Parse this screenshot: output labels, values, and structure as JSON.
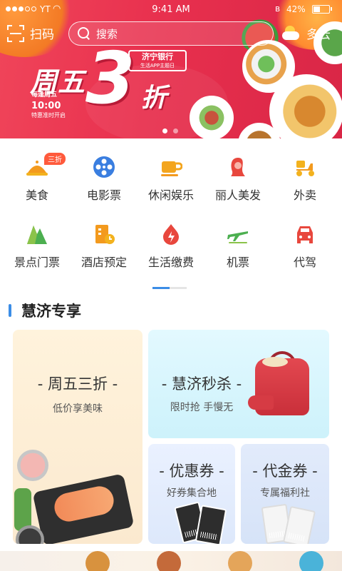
{
  "status_bar": {
    "carrier": "YT",
    "time": "9:41 AM",
    "battery_percent": "42%",
    "battery_level": 0.42
  },
  "header": {
    "scan_label": "扫码",
    "search_placeholder": "搜索",
    "weather_label": "多云"
  },
  "banner": {
    "title_prefix": "周五",
    "big_number": "3",
    "title_suffix": "折",
    "bank_name": "济宁银行",
    "bank_sub": "生活APP主题日",
    "schedule": "每逢周五",
    "time": "10:00",
    "note": "特惠准时开启",
    "page_count": 2,
    "active_page": 1
  },
  "categories": [
    {
      "label": "美食",
      "icon": "food-cloche-icon",
      "badge": "三折",
      "color": "#f39a1e"
    },
    {
      "label": "电影票",
      "icon": "film-reel-icon",
      "color": "#3a7ee0"
    },
    {
      "label": "休闲娱乐",
      "icon": "coffee-cup-icon",
      "color": "#f3a51e"
    },
    {
      "label": "丽人美发",
      "icon": "hair-beauty-icon",
      "color": "#e8473d"
    },
    {
      "label": "外卖",
      "icon": "delivery-scooter-icon",
      "color": "#f3b21e"
    },
    {
      "label": "景点门票",
      "icon": "mountain-icon",
      "color": "#4caf50"
    },
    {
      "label": "酒店预定",
      "icon": "hotel-building-icon",
      "color": "#f39a1e"
    },
    {
      "label": "生活缴费",
      "icon": "flame-utility-icon",
      "color": "#e8473d"
    },
    {
      "label": "机票",
      "icon": "airplane-icon",
      "color": "#4caf50"
    },
    {
      "label": "代驾",
      "icon": "car-icon",
      "color": "#e8473d"
    }
  ],
  "section": {
    "title": "慧济专享",
    "cards": {
      "friday": {
        "title": "- 周五三折 -",
        "subtitle": "低价享美味"
      },
      "flash_sale": {
        "title": "- 慧济秒杀 -",
        "subtitle": "限时抢 手慢无"
      },
      "coupon": {
        "title": "- 优惠券 -",
        "subtitle": "好券集合地"
      },
      "voucher": {
        "title": "- 代金券 -",
        "subtitle": "专属福利社"
      }
    }
  },
  "colors": {
    "banner_red": "#e8304e",
    "accent_blue": "#3b8de6"
  }
}
